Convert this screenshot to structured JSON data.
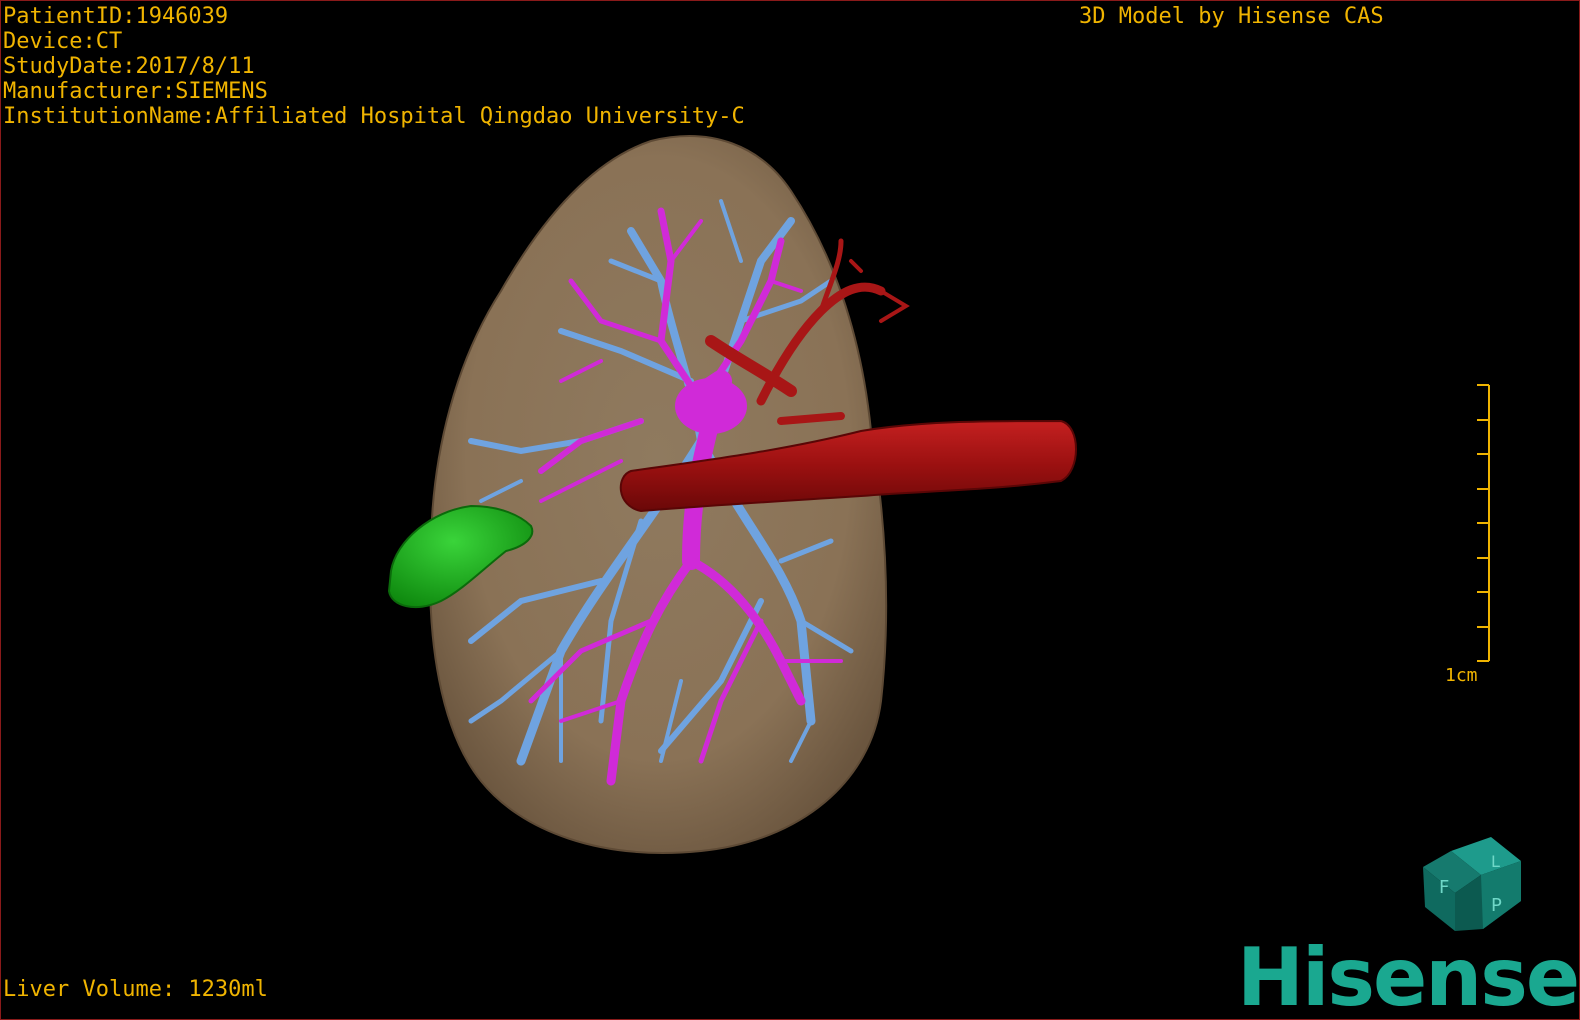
{
  "study": {
    "patient_id": "PatientID:1946039",
    "device": "Device:CT",
    "study_date": "StudyDate:2017/8/11",
    "manufacturer": "Manufacturer:SIEMENS",
    "institution": "InstitutionName:Affiliated Hospital Qingdao University-C"
  },
  "credit": "3D Model by Hisense CAS",
  "measurements": {
    "liver_volume": "Liver Volume: 1230ml",
    "scale_bar_label": "1cm"
  },
  "orientation_cube": {
    "face_letters": [
      "F",
      "L",
      "P"
    ]
  },
  "brand": {
    "name": "Hisense"
  },
  "colors": {
    "overlay_text": "#f0b400",
    "liver": "#8c7358",
    "portal_vein": "#d02ad8",
    "hepatic_vein": "#6fa3e0",
    "artery_ivc": "#a81616",
    "gallbladder": "#1bb01b",
    "brand": "#1aa890"
  },
  "anatomy": [
    {
      "name": "liver",
      "color": "#8c7358"
    },
    {
      "name": "portal-vein",
      "color": "#d02ad8"
    },
    {
      "name": "hepatic-vein",
      "color": "#6fa3e0"
    },
    {
      "name": "inferior-vena-cava",
      "color": "#a81616"
    },
    {
      "name": "hepatic-artery",
      "color": "#a81616"
    },
    {
      "name": "gallbladder",
      "color": "#1bb01b"
    }
  ]
}
